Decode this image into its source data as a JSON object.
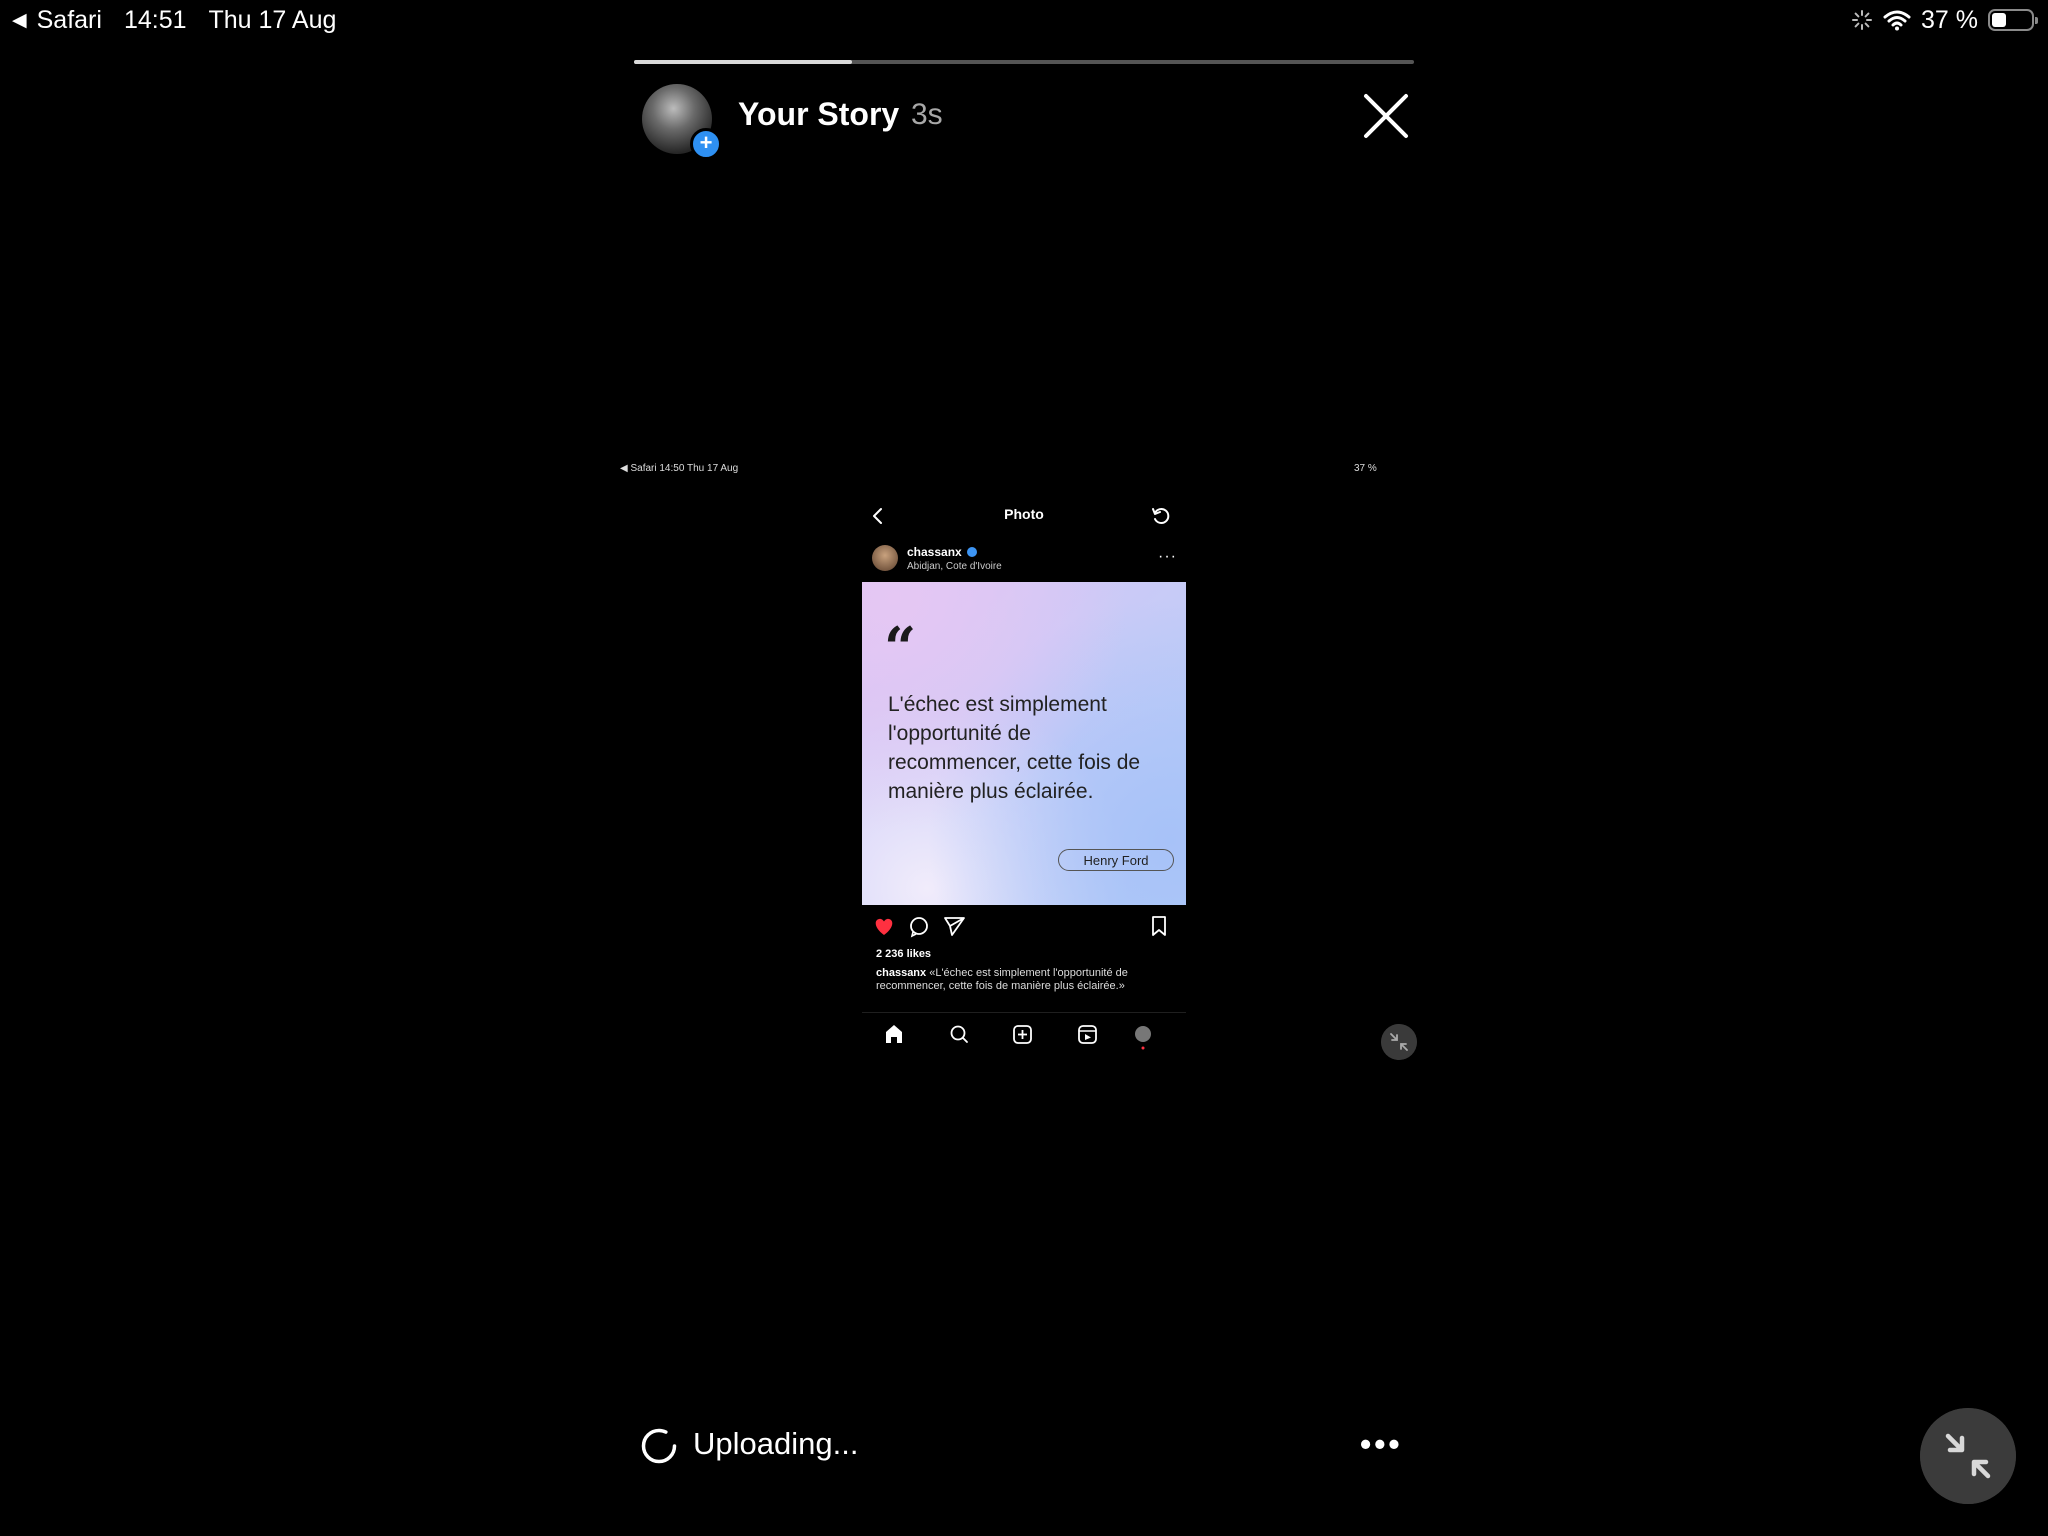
{
  "status_bar": {
    "app_back": "Safari",
    "time": "14:51",
    "date": "Thu 17 Aug",
    "battery": "37 %"
  },
  "story": {
    "title": "Your Story",
    "time_ago": "3s",
    "progress": 0.28
  },
  "embedded_screenshot": {
    "status_left": "◀ Safari   14:50   Thu 17 Aug",
    "status_right": "37 %",
    "nav_title": "Photo",
    "post": {
      "username": "chassanx",
      "location": "Abidjan, Cote d'Ivoire",
      "quote": "L'échec est simplement l'opportunité de recommencer, cette fois de manière plus éclairée.",
      "author": "Henry Ford",
      "likes": "2 236 likes",
      "caption_user": "chassanx",
      "caption_text": "«L'échec est simplement l'opportunité de recommencer, cette fois de manière plus éclairée.»"
    }
  },
  "footer": {
    "status": "Uploading..."
  },
  "colors": {
    "background": "#000000",
    "accent_blue": "#2e90f2",
    "like_red": "#ff3040"
  }
}
